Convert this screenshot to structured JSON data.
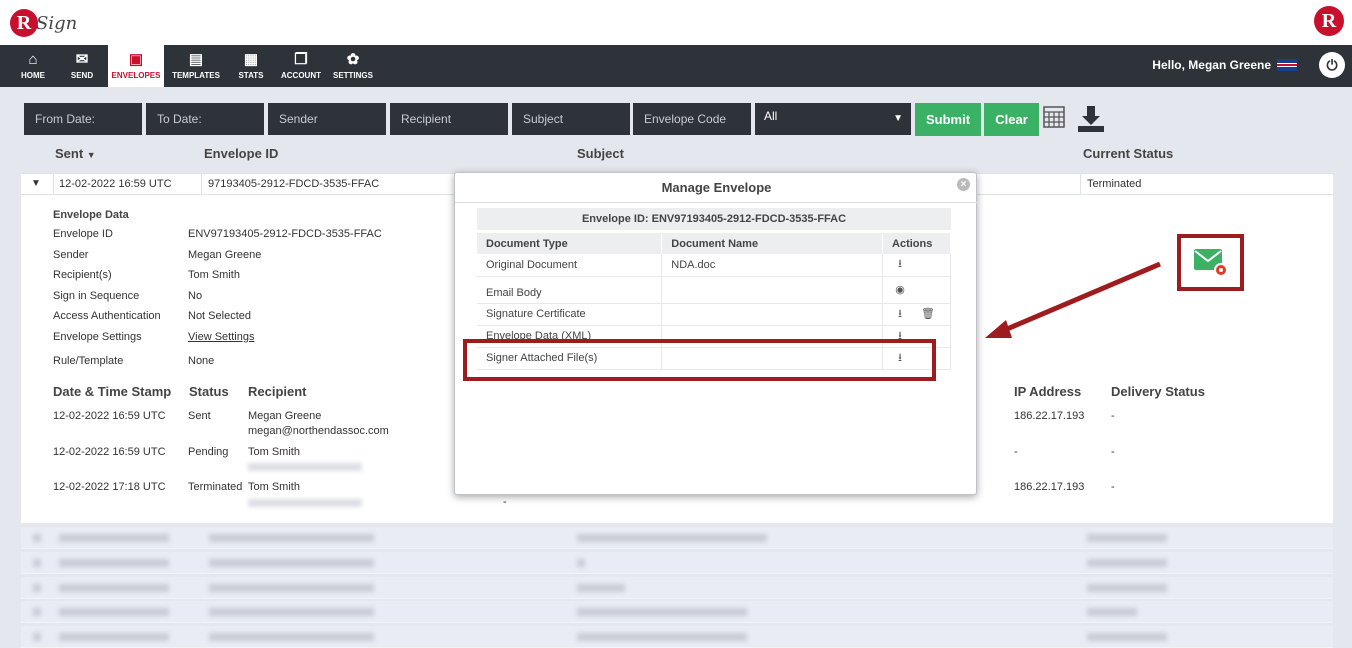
{
  "brand": {
    "logo_letter": "R",
    "logo_text": "Sign",
    "right_logo_letter": "R"
  },
  "nav": {
    "items": [
      {
        "label": "HOME",
        "icon": "home-icon",
        "glyph": "⌂"
      },
      {
        "label": "SEND",
        "icon": "envelope-icon",
        "glyph": "✉"
      },
      {
        "label": "ENVELOPES",
        "icon": "envelopes-icon",
        "glyph": "▣"
      },
      {
        "label": "TEMPLATES",
        "icon": "templates-icon",
        "glyph": "▤"
      },
      {
        "label": "STATS",
        "icon": "briefcase-icon",
        "glyph": "▦"
      },
      {
        "label": "ACCOUNT",
        "icon": "account-icon",
        "glyph": "❐"
      },
      {
        "label": "SETTINGS",
        "icon": "gear-icon",
        "glyph": "✿"
      }
    ],
    "active": "ENVELOPES",
    "greeting": "Hello, Megan Greene",
    "power_glyph": "⏻"
  },
  "filters": {
    "from_date": "From Date:",
    "to_date": "To Date:",
    "sender": "Sender",
    "recipient": "Recipient",
    "subject": "Subject",
    "envelope_code": "Envelope Code",
    "status_select": "All",
    "submit": "Submit",
    "clear": "Clear"
  },
  "columns": {
    "sent": "Sent",
    "envelope_id": "Envelope ID",
    "subject": "Subject",
    "current_status": "Current Status"
  },
  "row": {
    "sent": "12-02-2022 16:59 UTC",
    "envelope_id": "97193405-2912-FDCD-3535-FFAC",
    "status": "Terminated"
  },
  "envelope_data": {
    "heading": "Envelope Data",
    "fields": [
      {
        "label": "Envelope ID",
        "value": "ENV97193405-2912-FDCD-3535-FFAC"
      },
      {
        "label": "Sender",
        "value": "Megan Greene"
      },
      {
        "label": "Recipient(s)",
        "value": "Tom Smith"
      },
      {
        "label": "Sign in Sequence",
        "value": "No"
      },
      {
        "label": "Access Authentication",
        "value": "Not Selected"
      },
      {
        "label": "Envelope Settings",
        "value": "View Settings"
      },
      {
        "label": "Rule/Template",
        "value": "None"
      }
    ]
  },
  "history": {
    "headers": {
      "date": "Date & Time Stamp",
      "status": "Status",
      "recipient": "Recipient",
      "ip": "IP Address",
      "delivery": "Delivery Status"
    },
    "rows": [
      {
        "date": "12-02-2022 16:59 UTC",
        "status": "Sent",
        "recipient": "Megan Greene",
        "email": "megan@northendassoc.com",
        "ip": "186.22.17.193",
        "delivery": "-"
      },
      {
        "date": "12-02-2022 16:59 UTC",
        "status": "Pending",
        "recipient": "Tom Smith",
        "email": "",
        "ip": "-",
        "delivery": "-"
      },
      {
        "date": "12-02-2022 17:18 UTC",
        "status": "Terminated",
        "recipient": "Tom Smith",
        "email": "",
        "ip": "186.22.17.193",
        "delivery": "-"
      }
    ],
    "dash": "-"
  },
  "modal": {
    "title": "Manage Envelope",
    "close_glyph": "×",
    "envelope_id": "Envelope ID: ENV97193405-2912-FDCD-3535-FFAC",
    "headers": {
      "type": "Document Type",
      "name": "Document Name",
      "actions": "Actions"
    },
    "rows": [
      {
        "type": "Original Document",
        "name": "NDA.doc",
        "actions": [
          "download-icon"
        ]
      },
      {
        "type": "Email Body",
        "name": "",
        "actions": [
          "eye-icon"
        ]
      },
      {
        "type": "Signature Certificate",
        "name": "",
        "actions": [
          "download-icon",
          "trash-icon"
        ]
      },
      {
        "type": "Envelope Data (XML)",
        "name": "",
        "actions": [
          "download-icon"
        ]
      },
      {
        "type": "Signer Attached File(s)",
        "name": "",
        "actions": [
          "download-icon"
        ]
      }
    ]
  },
  "colors": {
    "nav_bg": "#2d3339",
    "accent_red": "#c8102e",
    "green": "#3ab164",
    "annotation_red": "#9e1b1e"
  }
}
